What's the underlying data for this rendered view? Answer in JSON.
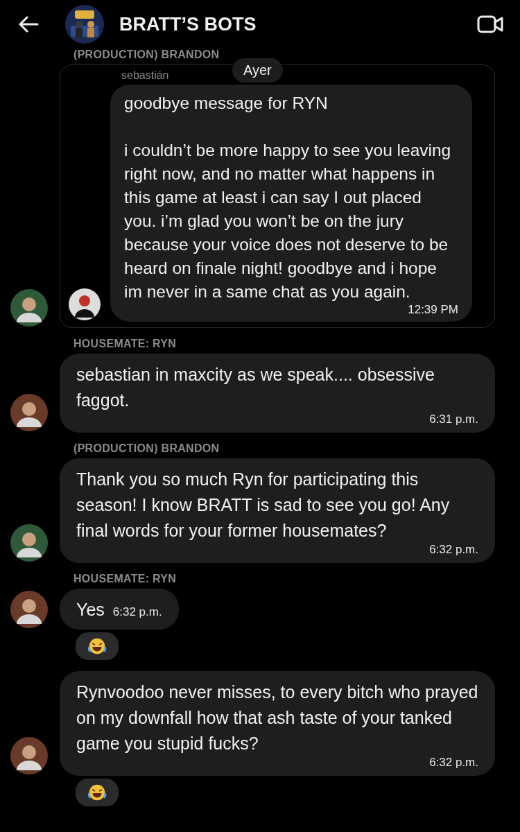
{
  "header": {
    "title": "BRATT’S BOTS"
  },
  "messages": [
    {
      "kind": "forward",
      "color": "#2e5a3a",
      "sender": "(PRODUCTION) BRANDON",
      "quote_author": "sebastián",
      "date_chip": "Ayer",
      "paragraphs": [
        "goodbye message for RYN",
        "i couldn’t be more happy to see you leaving right now, and no matter what happens in this game at least i can say I out placed you. i’m glad you won’t be on the jury because your voice does not deserve to be heard on finale night! goodbye and i hope im never in a same chat as you again."
      ],
      "time": "12:39 PM",
      "reacted": false
    },
    {
      "kind": "text",
      "color": "#6a3a28",
      "sender": "HOUSEMATE: RYN",
      "text": "sebastian in maxcity as we speak.... obsessive faggot.",
      "time": "6:31 p.m.",
      "reacted": false
    },
    {
      "kind": "text",
      "color": "#2e5a3a",
      "sender": "(PRODUCTION) BRANDON",
      "text": "Thank you so much Ryn for participating this season! I know BRATT is sad to see you go! Any final words for your former housemates?",
      "time": "6:32 p.m.",
      "reacted": false
    },
    {
      "kind": "text",
      "color": "#6a3a28",
      "sender": "HOUSEMATE: RYN",
      "text": "Yes",
      "time": "6:32 p.m.",
      "reacted": true
    },
    {
      "kind": "text",
      "color": "#6a3a28",
      "text": "Rynvoodoo never misses, to every bitch who prayed on my downfall how that ash taste of your tanked game you stupid fucks?",
      "time": "6:32 p.m.",
      "reacted": true
    }
  ]
}
